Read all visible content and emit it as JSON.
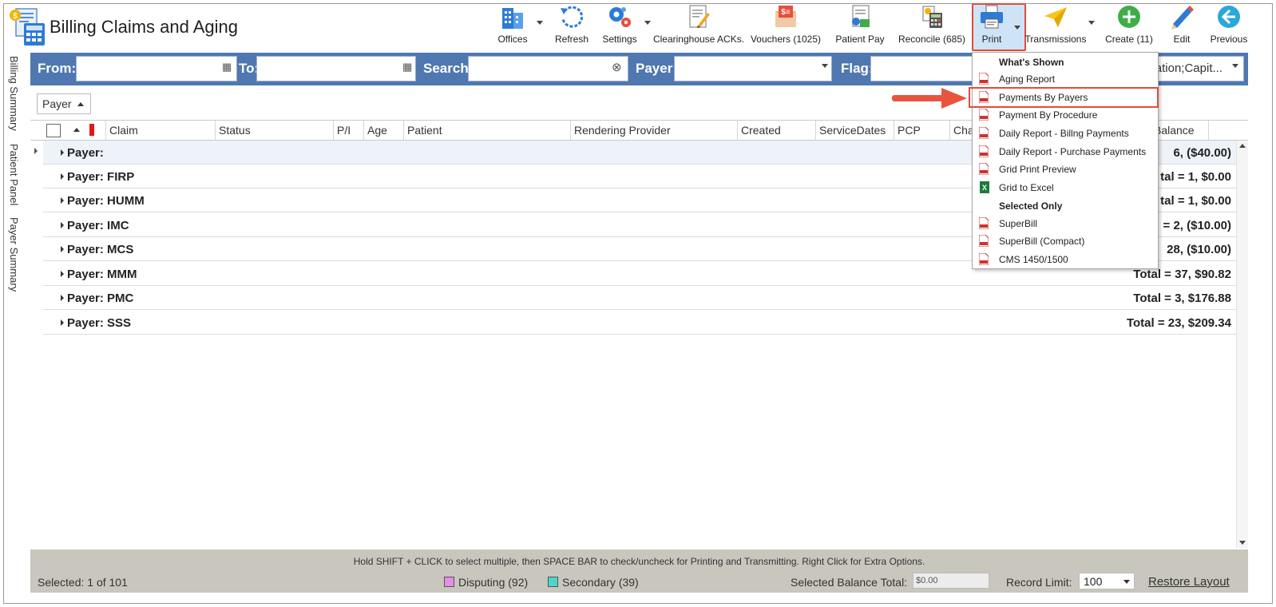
{
  "app": {
    "title": "Billing Claims and Aging"
  },
  "toolbar": {
    "offices": "Offices",
    "refresh": "Refresh",
    "settings": "Settings",
    "clearinghouse": "Clearinghouse ACKs.",
    "vouchers": "Vouchers (1025)",
    "patient_pay": "Patient Pay",
    "reconcile": "Reconcile (685)",
    "print": "Print",
    "transmissions": "Transmissions",
    "create": "Create (11)",
    "edit": "Edit",
    "previous": "Previous"
  },
  "filters": {
    "from_label": "From:",
    "to_label": "To:",
    "search_label": "Search:",
    "payer_label": "Payer:",
    "flag_label": "Flag:",
    "flag_value": "ation;Capit..."
  },
  "side_tabs": [
    "Billing Summary",
    "Patient Panel",
    "Payer Summary"
  ],
  "group_by": {
    "label": "Payer"
  },
  "grid": {
    "columns": [
      "Claim",
      "Status",
      "P/I",
      "Age",
      "Patient",
      "Rendering Provider",
      "Created",
      "ServiceDates",
      "PCP",
      "Cha",
      "Balance"
    ],
    "groups": [
      {
        "label": "Payer:",
        "total": "6,  ($40.00)"
      },
      {
        "label": "Payer: FIRP",
        "total": "tal = 1,  $0.00"
      },
      {
        "label": "Payer: HUMM",
        "total": "tal = 1,  $0.00"
      },
      {
        "label": "Payer: IMC",
        "total": "= 2,  ($10.00)"
      },
      {
        "label": "Payer: MCS",
        "total": "28,  ($10.00)"
      },
      {
        "label": "Payer: MMM",
        "total": "Total = 37,  $90.82"
      },
      {
        "label": "Payer: PMC",
        "total": "Total = 3,  $176.88"
      },
      {
        "label": "Payer: SSS",
        "total": "Total = 23,  $209.34"
      }
    ]
  },
  "print_menu": {
    "section_whats_shown": "What's Shown",
    "items_whats_shown": [
      "Aging Report",
      "Payments By Payers",
      "Payment By Procedure",
      "Daily Report - Billng Payments",
      "Daily Report - Purchase Payments",
      "Grid Print Preview",
      "Grid to Excel"
    ],
    "section_selected_only": "Selected Only",
    "items_selected_only": [
      "SuperBill",
      "SuperBill (Compact)",
      "CMS 1450/1500"
    ],
    "highlighted_item": "Payments By Payers"
  },
  "footer": {
    "hint": "Hold SHIFT + CLICK to select multiple, then SPACE BAR to check/uncheck for Printing and Transmitting. Right Click for Extra Options.",
    "selected": "Selected: 1 of 101",
    "disputing": "Disputing (92)",
    "secondary": "Secondary (39)",
    "selected_balance_label": "Selected Balance Total:",
    "selected_balance_value": "$0.00",
    "record_limit_label": "Record Limit:",
    "record_limit_value": "100",
    "restore_layout": "Restore Layout"
  },
  "colors": {
    "filter_bar": "#4f78b0",
    "highlight_red": "#e24a3c",
    "disputing": "#e58ee8",
    "secondary": "#4fd6c8",
    "footer": "#c9c6bd"
  }
}
